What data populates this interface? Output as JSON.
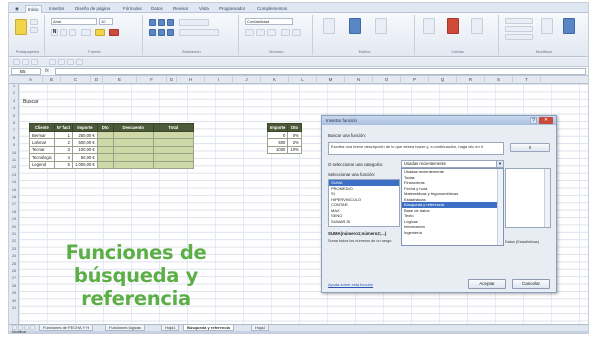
{
  "ribbon": {
    "tabs": [
      "Inicio",
      "Insertar",
      "Diseño de página",
      "Fórmulas",
      "Datos",
      "Revisar",
      "Vista",
      "Programador",
      "Complementos"
    ],
    "active_tab": "Inicio",
    "font_name": "Arial",
    "font_size": "10",
    "number_format": "Contabilidad",
    "groups": [
      "Portapapeles",
      "Fuente",
      "Alineación",
      "Número",
      "Estilos",
      "Celdas",
      "Modificar"
    ]
  },
  "formula_bar": {
    "name_box": "B5",
    "fx": "fx",
    "formula": ""
  },
  "columns": [
    "A",
    "B",
    "C",
    "D",
    "E",
    "F",
    "G",
    "H",
    "I",
    "J",
    "K",
    "L",
    "M",
    "N",
    "O",
    "P",
    "Q",
    "R",
    "S",
    "T"
  ],
  "rows": [
    "1",
    "2",
    "3",
    "4",
    "5",
    "6",
    "7",
    "8",
    "9",
    "10",
    "11",
    "12",
    "13",
    "14",
    "15",
    "16",
    "17",
    "18",
    "19",
    "20",
    "21",
    "22",
    "23",
    "24",
    "25",
    "26",
    "27",
    "28",
    "29",
    "30",
    "31"
  ],
  "sheet": {
    "title_cell": "Buscar",
    "table": {
      "headers": [
        "Cliente",
        "Nº fact",
        "Importe",
        "Dto",
        "Descuento",
        "Total"
      ],
      "rows": [
        [
          "Bermar",
          "1",
          "250,00 €"
        ],
        [
          "Lahmar",
          "2",
          "500,00 €"
        ],
        [
          "Tecnar",
          "3",
          "100,00 €"
        ],
        [
          "Tecnologic",
          "4",
          "50,00 €"
        ],
        [
          "Legend",
          "5",
          "1.000,00 €"
        ]
      ]
    },
    "side_table": {
      "headers": [
        "Importe",
        "Dto"
      ],
      "rows": [
        [
          "0",
          "0%"
        ],
        [
          "500",
          "2%"
        ],
        [
          "1000",
          "10%"
        ]
      ]
    }
  },
  "caption": [
    "Funciones de",
    "búsqueda y",
    "referencia"
  ],
  "dialog": {
    "title": "Insertar función",
    "search_label": "Buscar una función:",
    "search_text": "Escriba una breve descripción de lo que desea hacer y, a continuación, haga clic en Ir",
    "go_button": "Ir",
    "category_label": "O seleccionar una categoría:",
    "category_value": "Usadas recientemente",
    "category_options": [
      "Usadas recientemente",
      "Todas",
      "Financieras",
      "Fecha y hora",
      "Matemáticas y trigonométricas",
      "Estadísticas",
      "Búsqueda y referencia",
      "Base de datos",
      "Texto",
      "Lógicas",
      "Información",
      "Ingeniería"
    ],
    "selected_category": "Búsqueda y referencia",
    "function_label": "Seleccionar una función:",
    "functions": [
      "SUMA",
      "PROMEDIO",
      "SI",
      "HIPERVINCULO",
      "CONTAR",
      "MAX",
      "SENO",
      "SUMAR.SI",
      "PAGO",
      "DESVEST"
    ],
    "selected_function": "SUMA",
    "signature": "SUMA(número1;número2;...)",
    "description": "Suma todos los números de un rango.",
    "right_note": "Datos (Estadísticas)",
    "help_link": "Ayuda sobre esta función",
    "ok_button": "Aceptar",
    "cancel_button": "Cancelar",
    "close_glyph": "✕",
    "help_glyph": "?"
  },
  "sheet_tabs": [
    "Funciones de FECHA Y H",
    "Funciones lógicas",
    "Hoja1",
    "Búsqueda y referencia",
    "Hoja2"
  ],
  "active_sheet": "Búsqueda y referencia",
  "status": "Modificar",
  "colors": {
    "caption_green": "#5cae47",
    "header_olive": "#4d5a3a",
    "calc_fill": "#cfd9a7",
    "selection_blue": "#3d6fc4"
  }
}
